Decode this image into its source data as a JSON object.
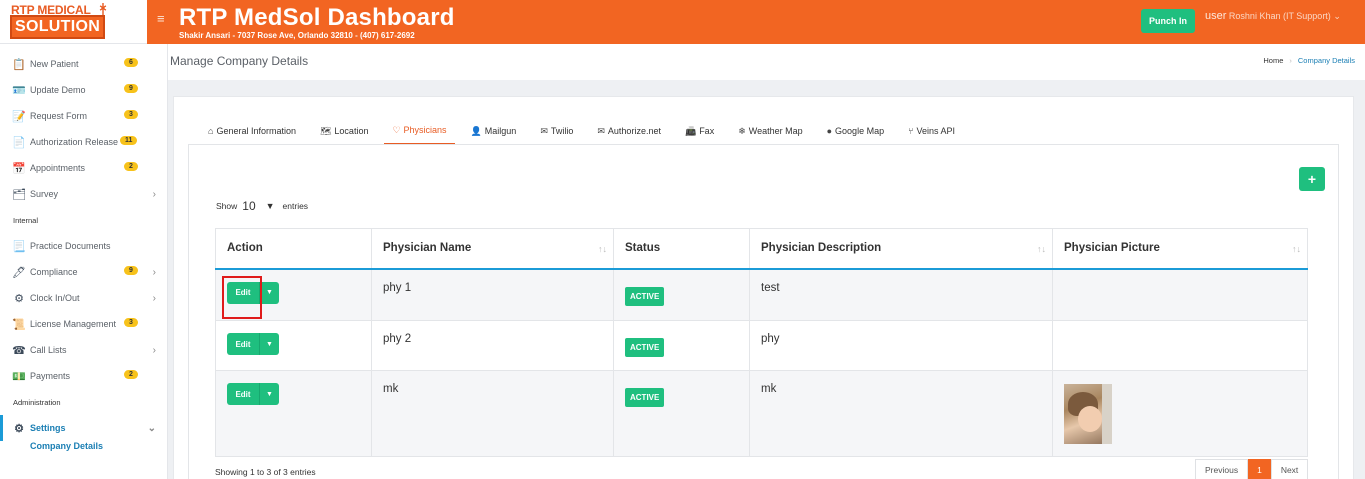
{
  "app": {
    "logo_top": "RTP MEDICAL",
    "logo_bottom": "SOLUTION",
    "title": "RTP MedSol Dashboard",
    "subtitle": "Shakir Ansari - 7037 Rose Ave, Orlando 32810 - (407) 617-2692",
    "punch_label": "Punch In",
    "user_img_alt": "user",
    "user_name": "Roshni Khan (IT Support)"
  },
  "sidebar": {
    "items": [
      {
        "label": "New Patient",
        "badge": "6"
      },
      {
        "label": "Update Demo",
        "badge": "9"
      },
      {
        "label": "Request Form",
        "badge": "3"
      },
      {
        "label": "Authorization Release",
        "badge": "11"
      },
      {
        "label": "Appointments",
        "badge": "2"
      },
      {
        "label": "Survey"
      }
    ],
    "section_internal": "Internal",
    "internal_items": [
      {
        "label": "Practice Documents"
      },
      {
        "label": "Compliance",
        "badge": "9"
      },
      {
        "label": "Clock In/Out"
      },
      {
        "label": "License Management",
        "badge": "3"
      },
      {
        "label": "Call Lists"
      },
      {
        "label": "Payments",
        "badge": "2"
      }
    ],
    "section_admin": "Administration",
    "settings_label": "Settings",
    "sub_company_details": "Company Details"
  },
  "page": {
    "title": "Manage Company Details",
    "breadcrumb_home": "Home",
    "breadcrumb_current": "Company Details"
  },
  "tabs": [
    {
      "label": "General Information",
      "icon": "home-icon"
    },
    {
      "label": "Location",
      "icon": "map-icon"
    },
    {
      "label": "Physicians",
      "icon": "heart-icon"
    },
    {
      "label": "Mailgun",
      "icon": "user-icon"
    },
    {
      "label": "Twilio",
      "icon": "envelope-icon"
    },
    {
      "label": "Authorize.net",
      "icon": "envelope-icon"
    },
    {
      "label": "Fax",
      "icon": "fax-icon"
    },
    {
      "label": "Weather Map",
      "icon": "snowflake-icon"
    },
    {
      "label": "Google Map",
      "icon": "map-pin-icon"
    },
    {
      "label": "Veins API",
      "icon": "branch-icon"
    }
  ],
  "table": {
    "show_label": "Show",
    "entries_value": "10",
    "entries_label": "entries",
    "add_label": "+",
    "columns": [
      "Action",
      "Physician Name",
      "Status",
      "Physician Description",
      "Physician Picture"
    ],
    "rows": [
      {
        "edit": "Edit",
        "name": "phy 1",
        "status": "ACTIVE",
        "description": "test"
      },
      {
        "edit": "Edit",
        "name": "phy 2",
        "status": "ACTIVE",
        "description": "phy"
      },
      {
        "edit": "Edit",
        "name": "mk",
        "status": "ACTIVE",
        "description": "mk"
      }
    ],
    "footer_info": "Showing 1 to 3 of 3 entries",
    "pager": {
      "previous": "Previous",
      "current": "1",
      "next": "Next"
    }
  },
  "colors": {
    "brand_orange": "#f26522",
    "success_green": "#1fbf7f",
    "link_blue": "#1b7fb4",
    "badge_yellow": "#f7c21b",
    "highlight_red": "#e01b1b"
  }
}
